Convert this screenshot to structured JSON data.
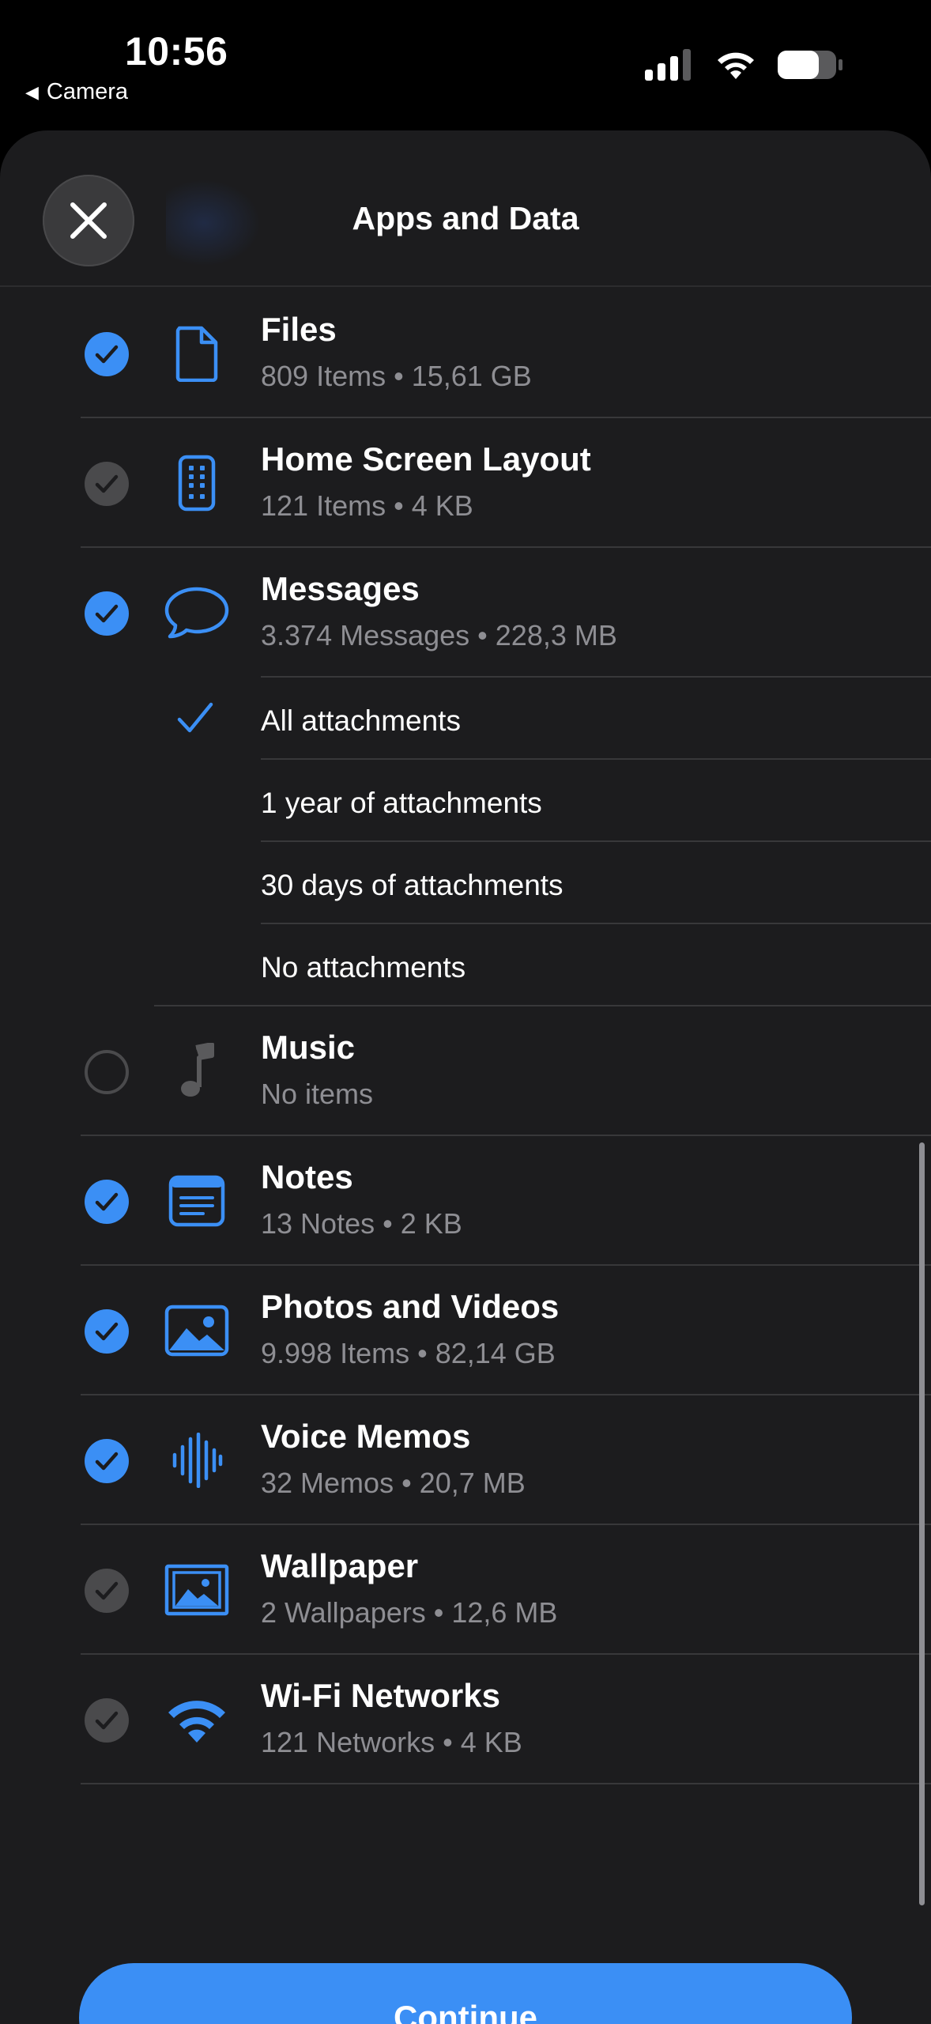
{
  "status_bar": {
    "time": "10:56",
    "back_app": "Camera"
  },
  "sheet": {
    "title": "Apps and Data",
    "continue_label": "Continue"
  },
  "colors": {
    "accent": "#3b8ff5",
    "check_gray": "#4a4a4c",
    "sheet_bg": "#1c1c1e",
    "secondary_text": "#8e8e93"
  },
  "items": [
    {
      "title": "Files",
      "subtitle": "809 Items • 15,61 GB",
      "icon": "file-icon",
      "state": "checked"
    },
    {
      "title": "Home Screen Layout",
      "subtitle": "121 Items • 4 KB",
      "icon": "home-screen-icon",
      "state": "checked-disabled"
    },
    {
      "title": "Messages",
      "subtitle": "3.374 Messages • 228,3 MB",
      "icon": "message-bubble-icon",
      "state": "checked"
    },
    {
      "title": "Music",
      "subtitle": "No items",
      "icon": "music-note-icon",
      "state": "unchecked"
    },
    {
      "title": "Notes",
      "subtitle": "13 Notes • 2 KB",
      "icon": "notes-icon",
      "state": "checked"
    },
    {
      "title": "Photos and Videos",
      "subtitle": "9.998 Items • 82,14 GB",
      "icon": "photo-icon",
      "state": "checked"
    },
    {
      "title": "Voice Memos",
      "subtitle": "32 Memos • 20,7 MB",
      "icon": "waveform-icon",
      "state": "checked"
    },
    {
      "title": "Wallpaper",
      "subtitle": "2 Wallpapers • 12,6 MB",
      "icon": "wallpaper-icon",
      "state": "checked-disabled"
    },
    {
      "title": "Wi-Fi Networks",
      "subtitle": "121 Networks • 4 KB",
      "icon": "wifi-icon",
      "state": "checked-disabled"
    }
  ],
  "message_options": [
    {
      "label": "All attachments",
      "selected": true
    },
    {
      "label": "1 year of attachments",
      "selected": false
    },
    {
      "label": "30 days of attachments",
      "selected": false
    },
    {
      "label": "No attachments",
      "selected": false
    }
  ]
}
